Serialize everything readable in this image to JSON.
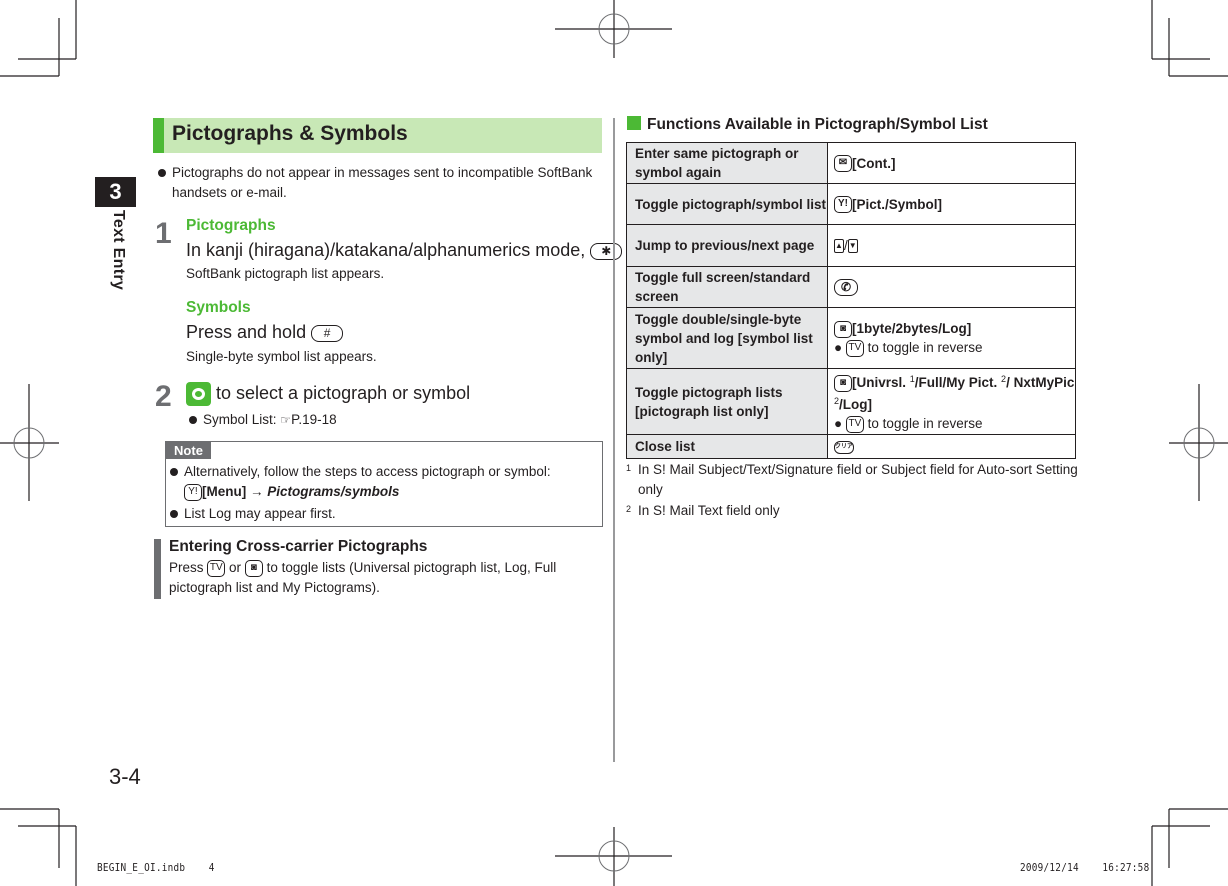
{
  "chapter": {
    "number": "3",
    "title": "Text Entry"
  },
  "page_number": "3-4",
  "slug": {
    "file": "BEGIN_E_OI.indb    4",
    "timestamp": "2009/12/14    16:27:58"
  },
  "section": {
    "title": "Pictographs & Symbols",
    "intro_bullet": "Pictographs do not appear in messages sent to incompatible SoftBank handsets or e-mail.",
    "steps": [
      {
        "number": "1",
        "parts": [
          {
            "subhead": "Pictographs",
            "instruction": "In kanji (hiragana)/katakana/alphanumerics mode,",
            "key_icon": "asterisk-key",
            "key_glyph": "✱",
            "result": "SoftBank pictograph list appears."
          },
          {
            "subhead": "Symbols",
            "instruction": "Press and hold",
            "key_icon": "hash-key",
            "key_glyph": "#",
            "result": "Single-byte symbol list appears."
          }
        ]
      },
      {
        "number": "2",
        "instruction": "to select a pictograph or symbol",
        "key_icon": "multi-selector-key",
        "bullet": {
          "label": "Symbol List:",
          "ref_icon": "reference-hand-icon",
          "ref": "P.19-18"
        }
      }
    ],
    "note": {
      "label": "Note",
      "bullets": [
        {
          "text": "Alternatively, follow the steps to access pictograph or symbol:",
          "key_icon": "yahoo-key",
          "key_glyph": "Y!",
          "menu": "[Menu]",
          "arrow": "→",
          "path": "Pictograms/symbols"
        },
        {
          "text": "List Log may appear first."
        }
      ]
    },
    "cross_carrier": {
      "title": "Entering Cross-carrier Pictographs",
      "press": "Press",
      "key1_icon": "tv-key",
      "key1_glyph": "TV",
      "or": "or",
      "key2_icon": "camera-key",
      "key2_glyph": "◙",
      "text": "to toggle lists (Universal pictograph list, Log, Full pictograph list and My Pictograms)."
    }
  },
  "functions": {
    "title": "Functions Available in Pictograph/Symbol List",
    "rows": [
      {
        "label": "Enter same pictograph or symbol again",
        "key_icon": "mail-key",
        "key_glyph": "✉",
        "value": "[Cont.]"
      },
      {
        "label": "Toggle pictograph/symbol list",
        "key_icon": "yahoo-key",
        "key_glyph": "Y!",
        "value": "[Pict./Symbol]"
      },
      {
        "label": "Jump to previous/next page",
        "key_icon": "side-up-down-keys",
        "up_glyph": "▲",
        "sep": "/",
        "down_glyph": "▼",
        "value": ""
      },
      {
        "label": "Toggle full screen/standard screen",
        "key_icon": "start-call-key",
        "key_glyph": "✆",
        "value": ""
      },
      {
        "label": "Toggle double/single-byte symbol and log [symbol list only]",
        "key_icon": "camera-key",
        "key_glyph": "◙",
        "value": "[1byte/2bytes/Log]",
        "sub_key_icon": "tv-key",
        "sub_key_glyph": "TV",
        "sub_text": "to toggle in reverse"
      },
      {
        "label": "Toggle pictograph lists [pictograph list only]",
        "key_icon": "camera-key",
        "key_glyph": "◙",
        "value_parts": [
          "[Univrsl. ",
          "1",
          "/Full/My Pict. ",
          "2",
          "/ NxtMyPic ",
          "2",
          "/Log]"
        ],
        "sub_key_icon": "tv-key",
        "sub_key_glyph": "TV",
        "sub_text": "to toggle in reverse"
      },
      {
        "label": "Close list",
        "key_icon": "clear-back-key",
        "key_glyph": "クリア",
        "value": ""
      }
    ],
    "footnotes": [
      {
        "mark": "1",
        "text": "In S! Mail Subject/Text/Signature field or Subject field for Auto-sort Setting only"
      },
      {
        "mark": "2",
        "text": "In S! Mail Text field only"
      }
    ]
  }
}
